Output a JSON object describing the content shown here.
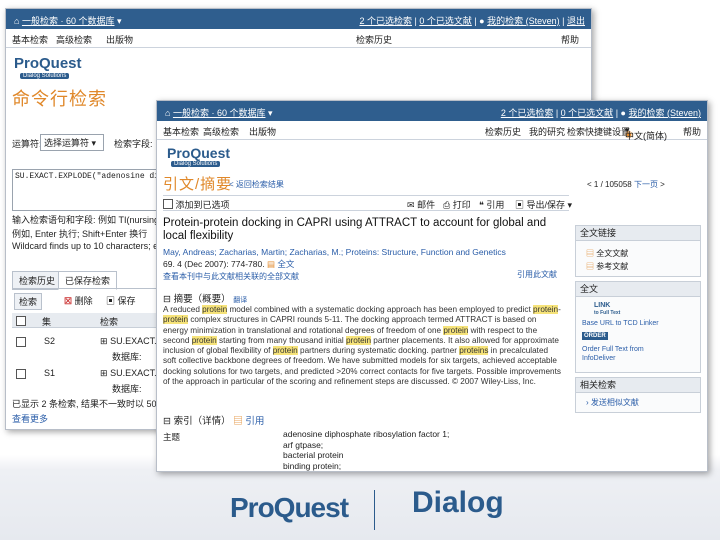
{
  "back_window": {
    "topbar_left": "一般检索 · 60 个数据库",
    "topbar_right": [
      "2 个已选检索",
      "0 个已选文献",
      "我的检索 (Steven)",
      "退出"
    ],
    "menu": [
      "基本检索",
      "高级检索",
      "出版物",
      "检索历史",
      "帮助"
    ],
    "logo": "ProQuest",
    "logo_sub": "Dialog Solutions",
    "page_title": "命令行检索",
    "field_label": "运算符:",
    "field_value": "选择运算符",
    "field_label2": "检索字段:",
    "query_text": "SU.EXACT.EXPLODE(\"adenosine diph",
    "help1": "输入检索语句和字段: 例如 TI(nursing)",
    "help2": "例如, Enter 执行; Shift+Enter 换行",
    "help3": "Wildcard finds up to 10 characters; e.g. ...",
    "tabs": [
      "检索历史",
      "已保存检索"
    ],
    "actions": [
      "检索",
      "删除",
      "保存"
    ],
    "col_headers": [
      "集",
      "检索"
    ],
    "rows": [
      {
        "set": "S2",
        "query": "SU.EXACT.EX",
        "sub": "数据库:"
      },
      {
        "set": "S1",
        "query": "SU.EXACT.EX",
        "sub": "数据库:"
      }
    ],
    "footer": "已显示 2 条检索, 结果不一致时以 5000 个",
    "footer2": "查看更多"
  },
  "front_window": {
    "topbar_left": "一般检索 · 60 个数据库",
    "topbar_right": [
      "2 个已选检索",
      "0 个已选文献",
      "我的检索 (Steven)"
    ],
    "menu_left": [
      "基本检索",
      "高级检索",
      "出版物"
    ],
    "menu_right": [
      "检索历史",
      "我的研究",
      "检索快捷键设置",
      "中文(简体)",
      "帮助"
    ],
    "logo": "ProQuest",
    "logo_sub": "Dialog Solutions",
    "page_title": "引文/摘要",
    "back_link": "返回检索结果",
    "nav_count": "1 / 105058",
    "nav_next": "下一页",
    "toolbar": [
      "添加到已选项",
      "邮件",
      "打印",
      "引用",
      "导出/保存"
    ],
    "article_title": "Protein-protein docking in CAPRI using ATTRACT to account for global and local flexibility",
    "authors": "May, Andreas; Zacharias, Martin; Zacharias, M.; Proteins: Structure, Function and Genetics",
    "citation": "69. 4 (Dec 2007): 774-780.",
    "fulltext_link": "全文",
    "links_line": "查看本刊中与此文献相关联的全部文献",
    "cited_link": "引用此文献",
    "abstract_heading": "摘要（概要）",
    "abstract_tag": "翻译",
    "abstract": [
      {
        "t": "A reduced "
      },
      {
        "t": "protein",
        "h": true
      },
      {
        "t": " model combined with a systematic docking approach has been employed to predict "
      },
      {
        "t": "protein",
        "h": true
      },
      {
        "t": "-"
      },
      {
        "t": "protein",
        "h": true
      },
      {
        "t": " complex structures in CAPRI rounds 5-11. The docking approach termed ATTRACT is based on energy minimization in translational and rotational degrees of freedom of one "
      },
      {
        "t": "protein",
        "h": true
      },
      {
        "t": " with respect to the second "
      },
      {
        "t": "protein",
        "h": true
      },
      {
        "t": " starting from many thousand initial "
      },
      {
        "t": "protein",
        "h": true
      },
      {
        "t": " partner placements. It also allowed for approximate inclusion of global flexibility of "
      },
      {
        "t": "protein",
        "h": true
      },
      {
        "t": " partners during systematic docking. "
      },
      {
        "t": "partner "
      },
      {
        "t": "proteins",
        "h": true
      },
      {
        "t": " in precalculated soft collective backbone degrees of freedom. We have submitted models for six targets, achieved acceptable docking solutions for two targets, and predicted >20% correct contacts for five targets. Possible improvements of the approach in particular of the scoring and refinement steps are discussed. © 2007 Wiley-Liss, Inc."
      }
    ],
    "index_heading": "索引（详情）",
    "index_link": "引用",
    "subject_label": "主题",
    "subjects": [
      "adenosine diphosphate ribosylation factor 1;",
      "arf gtpase;",
      "bacterial protein",
      "binding protein;"
    ],
    "side_panel1_title": "全文链接",
    "side_panel1_items": [
      "全文文献",
      "参考文献"
    ],
    "side_panel2_title": "全文",
    "link_badge": "LINK",
    "link_badge_sub": "to Full Text",
    "link_text": "Base URL to TCD Linker",
    "order_badge": "ORDER",
    "order_text1": "Order Full Text from",
    "order_text2": "InfoDeliver",
    "side_panel3_title": "相关检索",
    "side_panel3_item": "发送相似文献"
  },
  "footer_logos": {
    "left": "ProQuest",
    "right": "Dialog"
  },
  "colors": {
    "accent": "#2f5e8e",
    "orange": "#e0882a",
    "highlight": "#f6e37a"
  }
}
